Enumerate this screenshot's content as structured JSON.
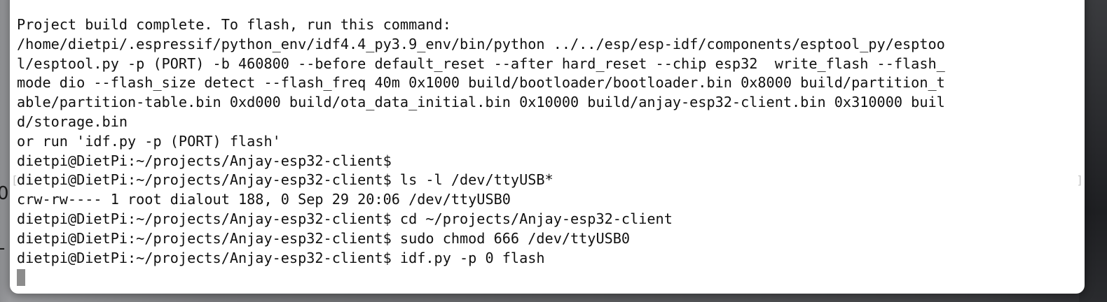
{
  "terminal": {
    "lines": [
      "Project build complete. To flash, run this command:",
      "/home/dietpi/.espressif/python_env/idf4.4_py3.9_env/bin/python ../../esp/esp-idf/components/esptool_py/esptoo",
      "l/esptool.py -p (PORT) -b 460800 --before default_reset --after hard_reset --chip esp32  write_flash --flash_",
      "mode dio --flash_size detect --flash_freq 40m 0x1000 build/bootloader/bootloader.bin 0x8000 build/partition_t",
      "able/partition-table.bin 0xd000 build/ota_data_initial.bin 0x10000 build/anjay-esp32-client.bin 0x310000 buil",
      "d/storage.bin",
      "or run 'idf.py -p (PORT) flash'",
      "dietpi@DietPi:~/projects/Anjay-esp32-client$",
      "dietpi@DietPi:~/projects/Anjay-esp32-client$ ls -l /dev/ttyUSB*",
      "crw-rw---- 1 root dialout 188, 0 Sep 29 20:06 /dev/ttyUSB0",
      "dietpi@DietPi:~/projects/Anjay-esp32-client$ cd ~/projects/Anjay-esp32-client",
      "dietpi@DietPi:~/projects/Anjay-esp32-client$ sudo chmod 666 /dev/ttyUSB0",
      "dietpi@DietPi:~/projects/Anjay-esp32-client$ idf.py -p 0 flash"
    ],
    "mark_left": "[",
    "mark_right": "]"
  },
  "background": {
    "glyph_0": "0",
    "glyph_dash": "-"
  },
  "colors": {
    "terminal_bg": "#ffffff",
    "terminal_text": "#111111",
    "cursor": "#8c8c8c"
  }
}
